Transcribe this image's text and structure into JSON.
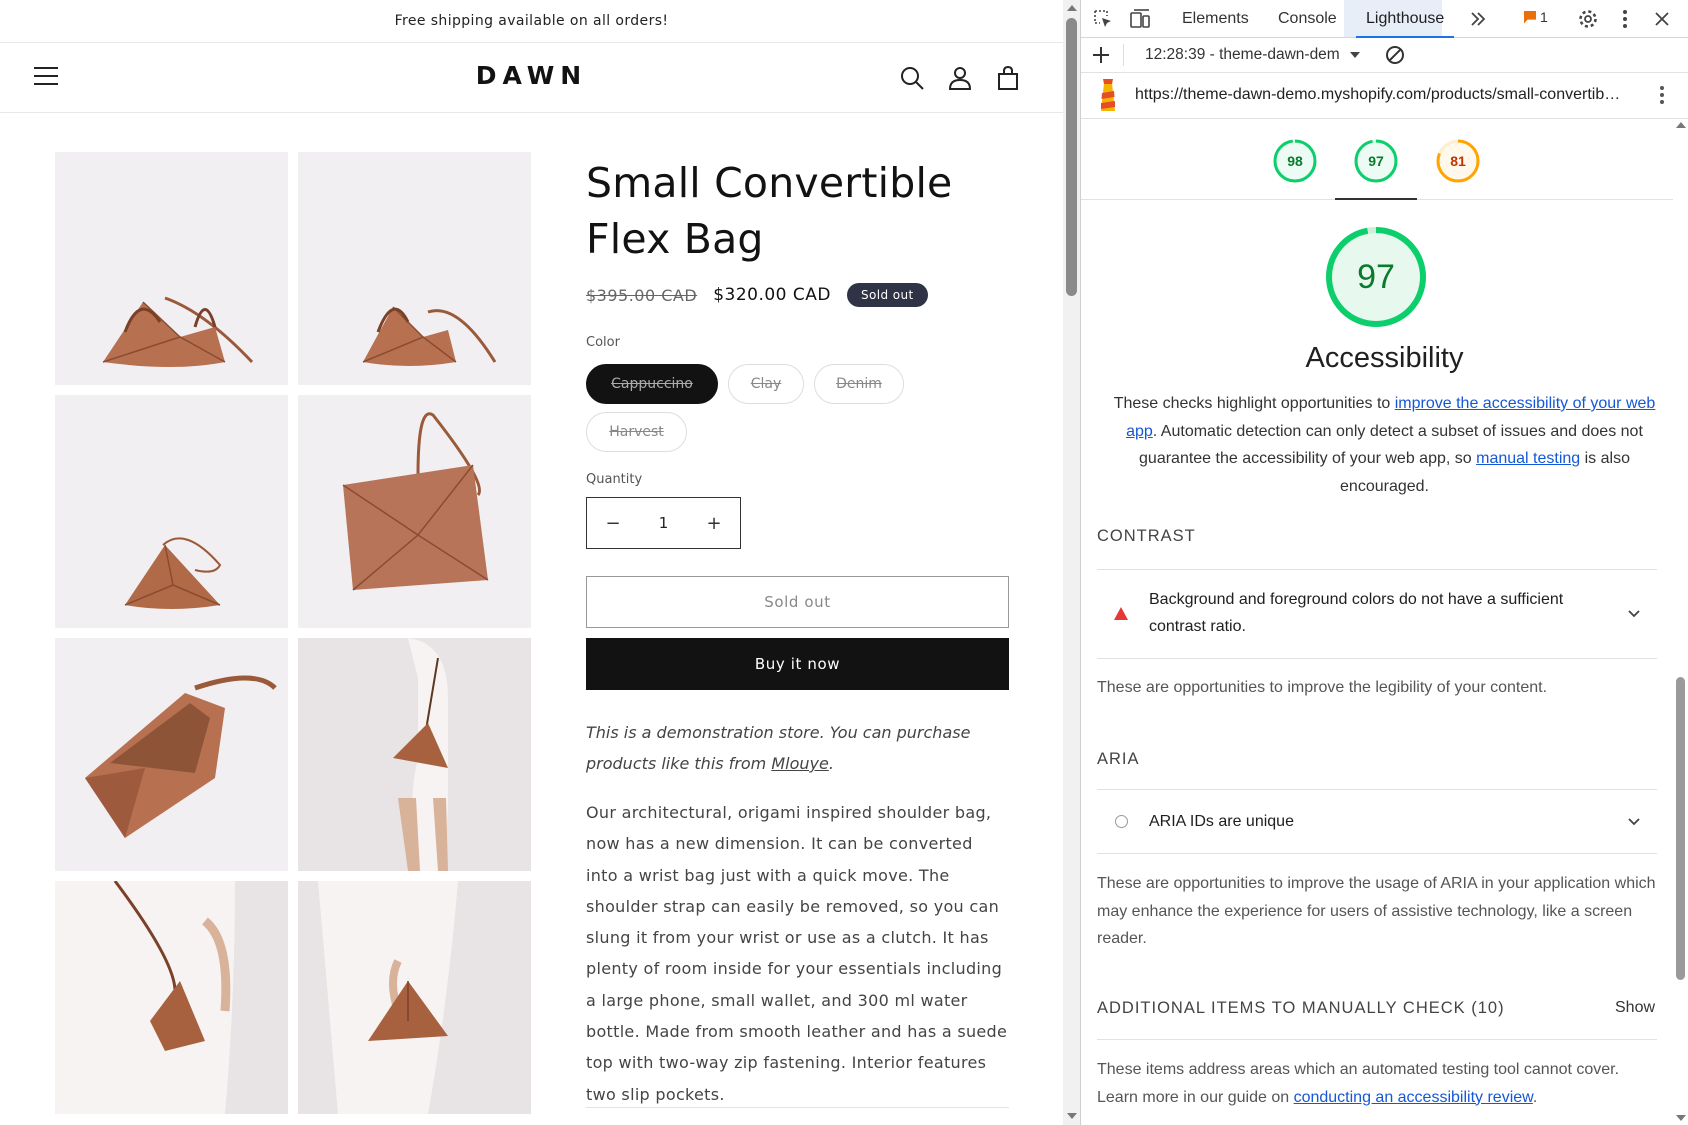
{
  "store": {
    "announcement": "Free shipping available on all orders!",
    "logo": "DAWN",
    "product": {
      "title": "Small Convertible Flex Bag",
      "price_original": "$395.00 CAD",
      "price_sale": "$320.00 CAD",
      "badge": "Sold out",
      "color_label": "Color",
      "colors": [
        "Cappuccino",
        "Clay",
        "Denim",
        "Harvest"
      ],
      "selected_color": "Cappuccino",
      "quantity_label": "Quantity",
      "quantity_value": "1",
      "sold_out_button": "Sold out",
      "buy_now_button": "Buy it now",
      "demo_note_prefix": "This is a demonstration store. You can purchase products like this from ",
      "demo_note_link": "Mlouye",
      "demo_note_suffix": ".",
      "description": "Our architectural, origami inspired shoulder bag, now has a new dimension. It can be converted into a wrist bag just with a quick move. The shoulder strap can easily be removed, so you can slung it from your wrist or use as a clutch. It has plenty of room inside for your essentials including a large phone, small wallet, and 300 ml water bottle. Made from smooth leather and has a suede top with two-way zip fastening. Interior features two slip pockets."
    },
    "icons": [
      "menu-icon",
      "search-icon",
      "account-icon",
      "cart-icon"
    ]
  },
  "devtools": {
    "tabs": [
      "Elements",
      "Console",
      "Lighthouse"
    ],
    "active_tab": "Lighthouse",
    "issues_count": "1",
    "report_select": "12:28:39 - theme-dawn-dem",
    "url": "https://theme-dawn-demo.myshopify.com/products/small-convertib…",
    "scores": [
      {
        "value": "98",
        "color": "#0cce6b",
        "text_color": "#0a7a2c"
      },
      {
        "value": "97",
        "color": "#0cce6b",
        "text_color": "#0a7a2c"
      },
      {
        "value": "81",
        "color": "#ffa400",
        "text_color": "#c33300"
      }
    ],
    "category": {
      "score": "97",
      "score_fraction": 0.97,
      "title": "Accessibility",
      "desc_1": "These checks highlight opportunities to ",
      "desc_link_1": "improve the accessibility of your web app",
      "desc_2": ". Automatic detection can only detect a subset of issues and does not guarantee the accessibility of your web app, so ",
      "desc_link_2": "manual testing",
      "desc_3": " is also encouraged."
    },
    "sections": {
      "contrast_title": "CONTRAST",
      "contrast_audit": "Background and foreground colors do not have a sufficient contrast ratio.",
      "contrast_desc": "These are opportunities to improve the legibility of your content.",
      "aria_title": "ARIA",
      "aria_audit": "ARIA IDs are unique",
      "aria_desc": "These are opportunities to improve the usage of ARIA in your application which may enhance the experience for users of assistive technology, like a screen reader.",
      "manual_title": "ADDITIONAL ITEMS TO MANUALLY CHECK (10)",
      "manual_show": "Show",
      "manual_desc_1": "These items address areas which an automated testing tool cannot cover. Learn more in our guide on ",
      "manual_link": "conducting an accessibility review",
      "manual_desc_2": "."
    },
    "colors": {
      "accent": "#1a73e8",
      "pass": "#0cce6b",
      "average": "#ffa400",
      "fail": "#e53935",
      "link": "#1558d6"
    }
  }
}
